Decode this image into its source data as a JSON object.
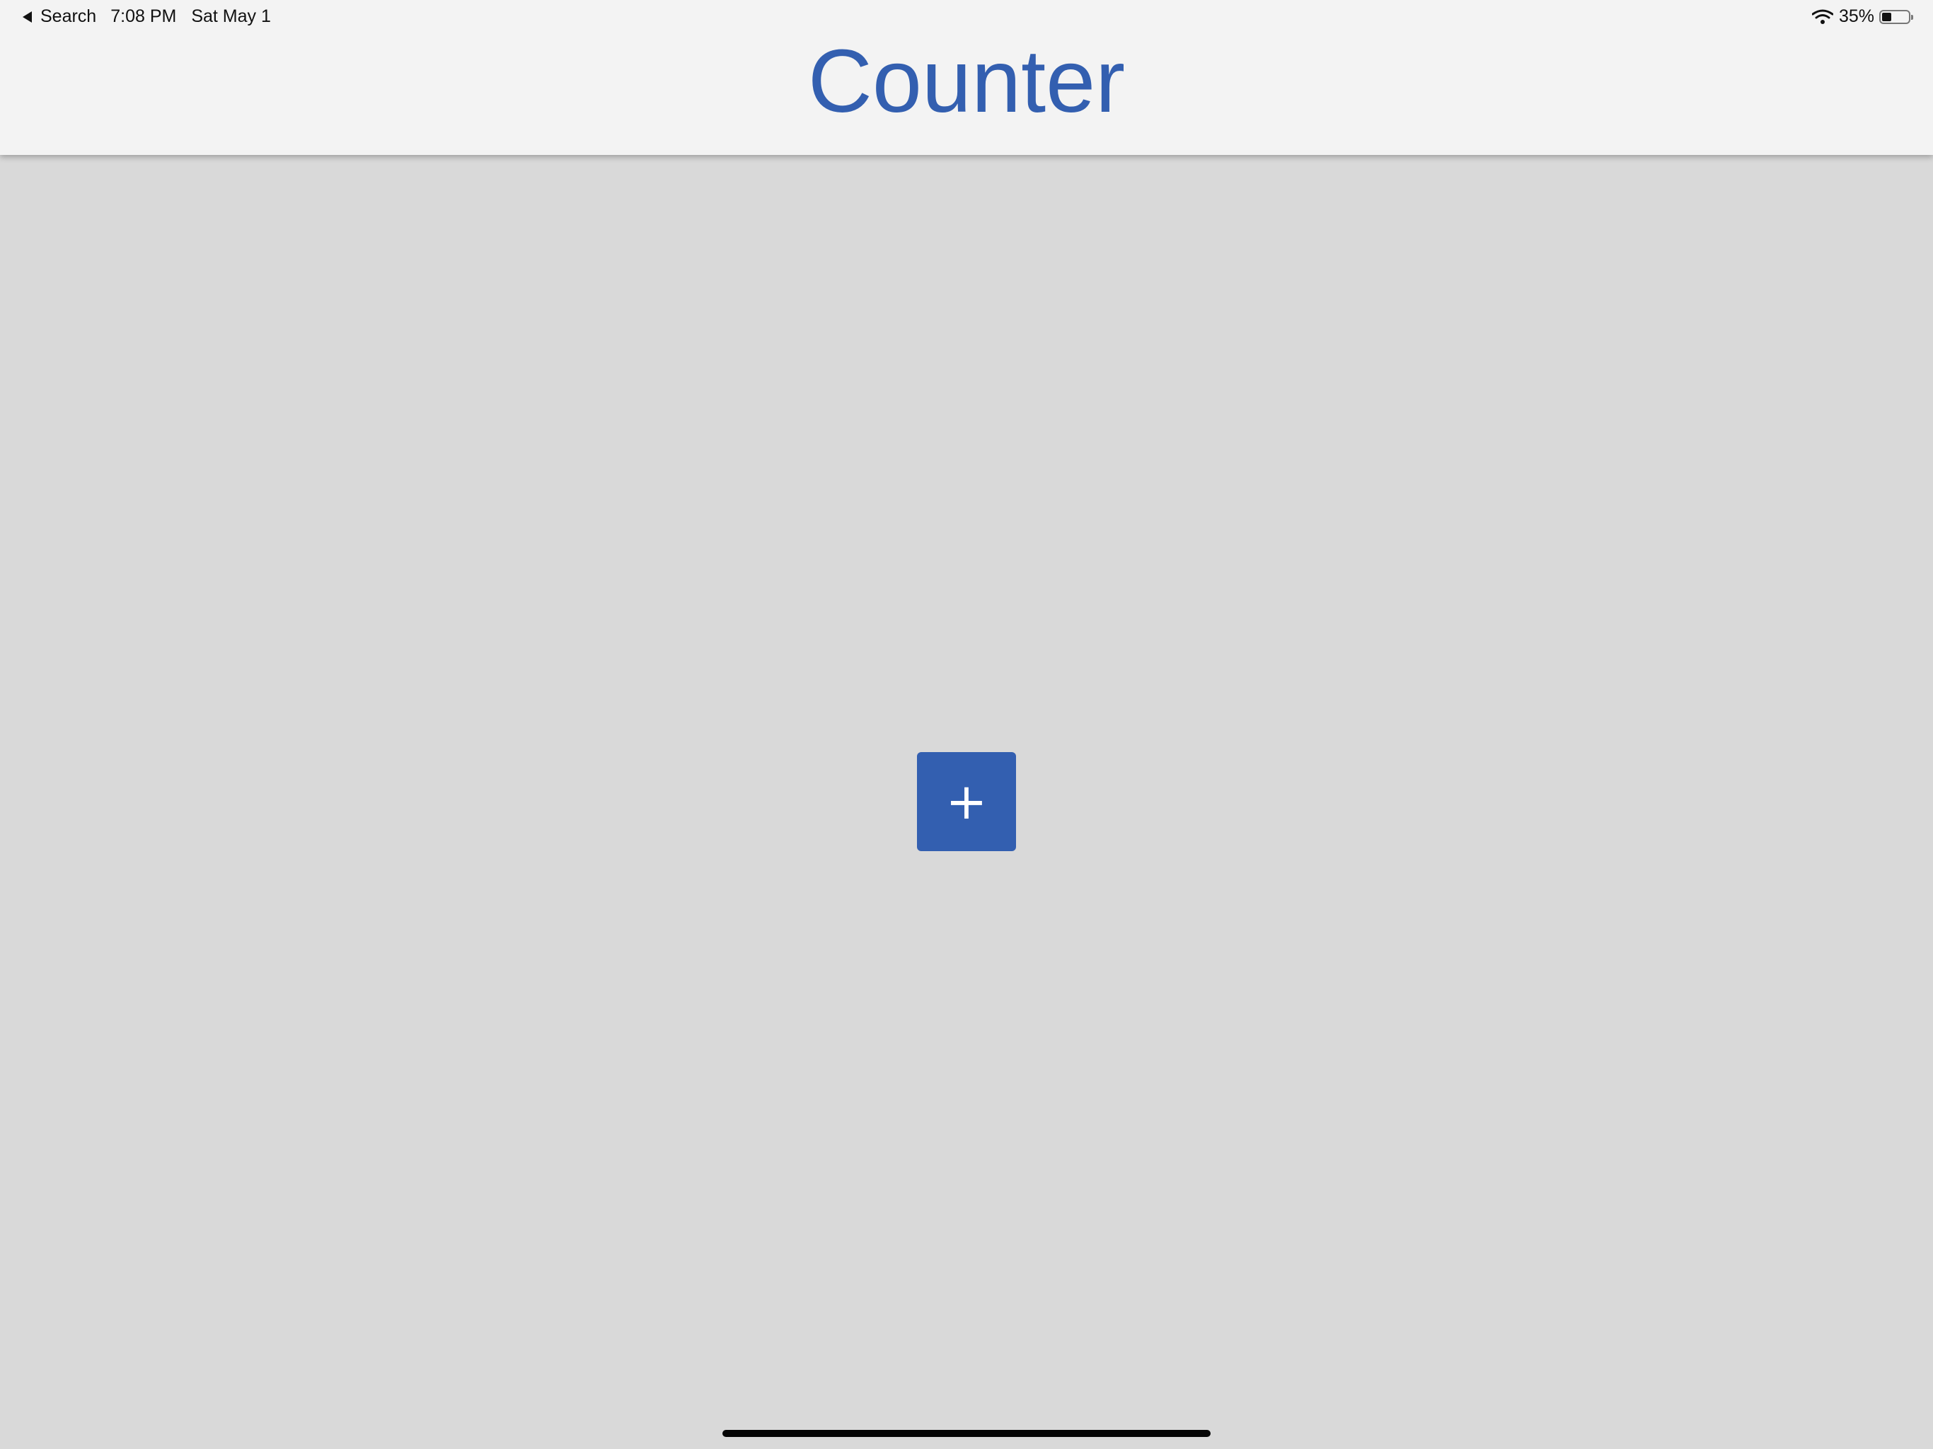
{
  "status_bar": {
    "back_label": "Search",
    "time": "7:08 PM",
    "date": "Sat May 1",
    "battery_text": "35%",
    "battery_level": 0.35
  },
  "header": {
    "title": "Counter"
  },
  "main": {
    "increment_label": "+"
  },
  "colors": {
    "accent": "#335fb0",
    "background": "#d9d9d9",
    "header_background": "#f3f3f3"
  },
  "icons": [
    "back-icon",
    "wifi-icon",
    "battery-icon"
  ]
}
